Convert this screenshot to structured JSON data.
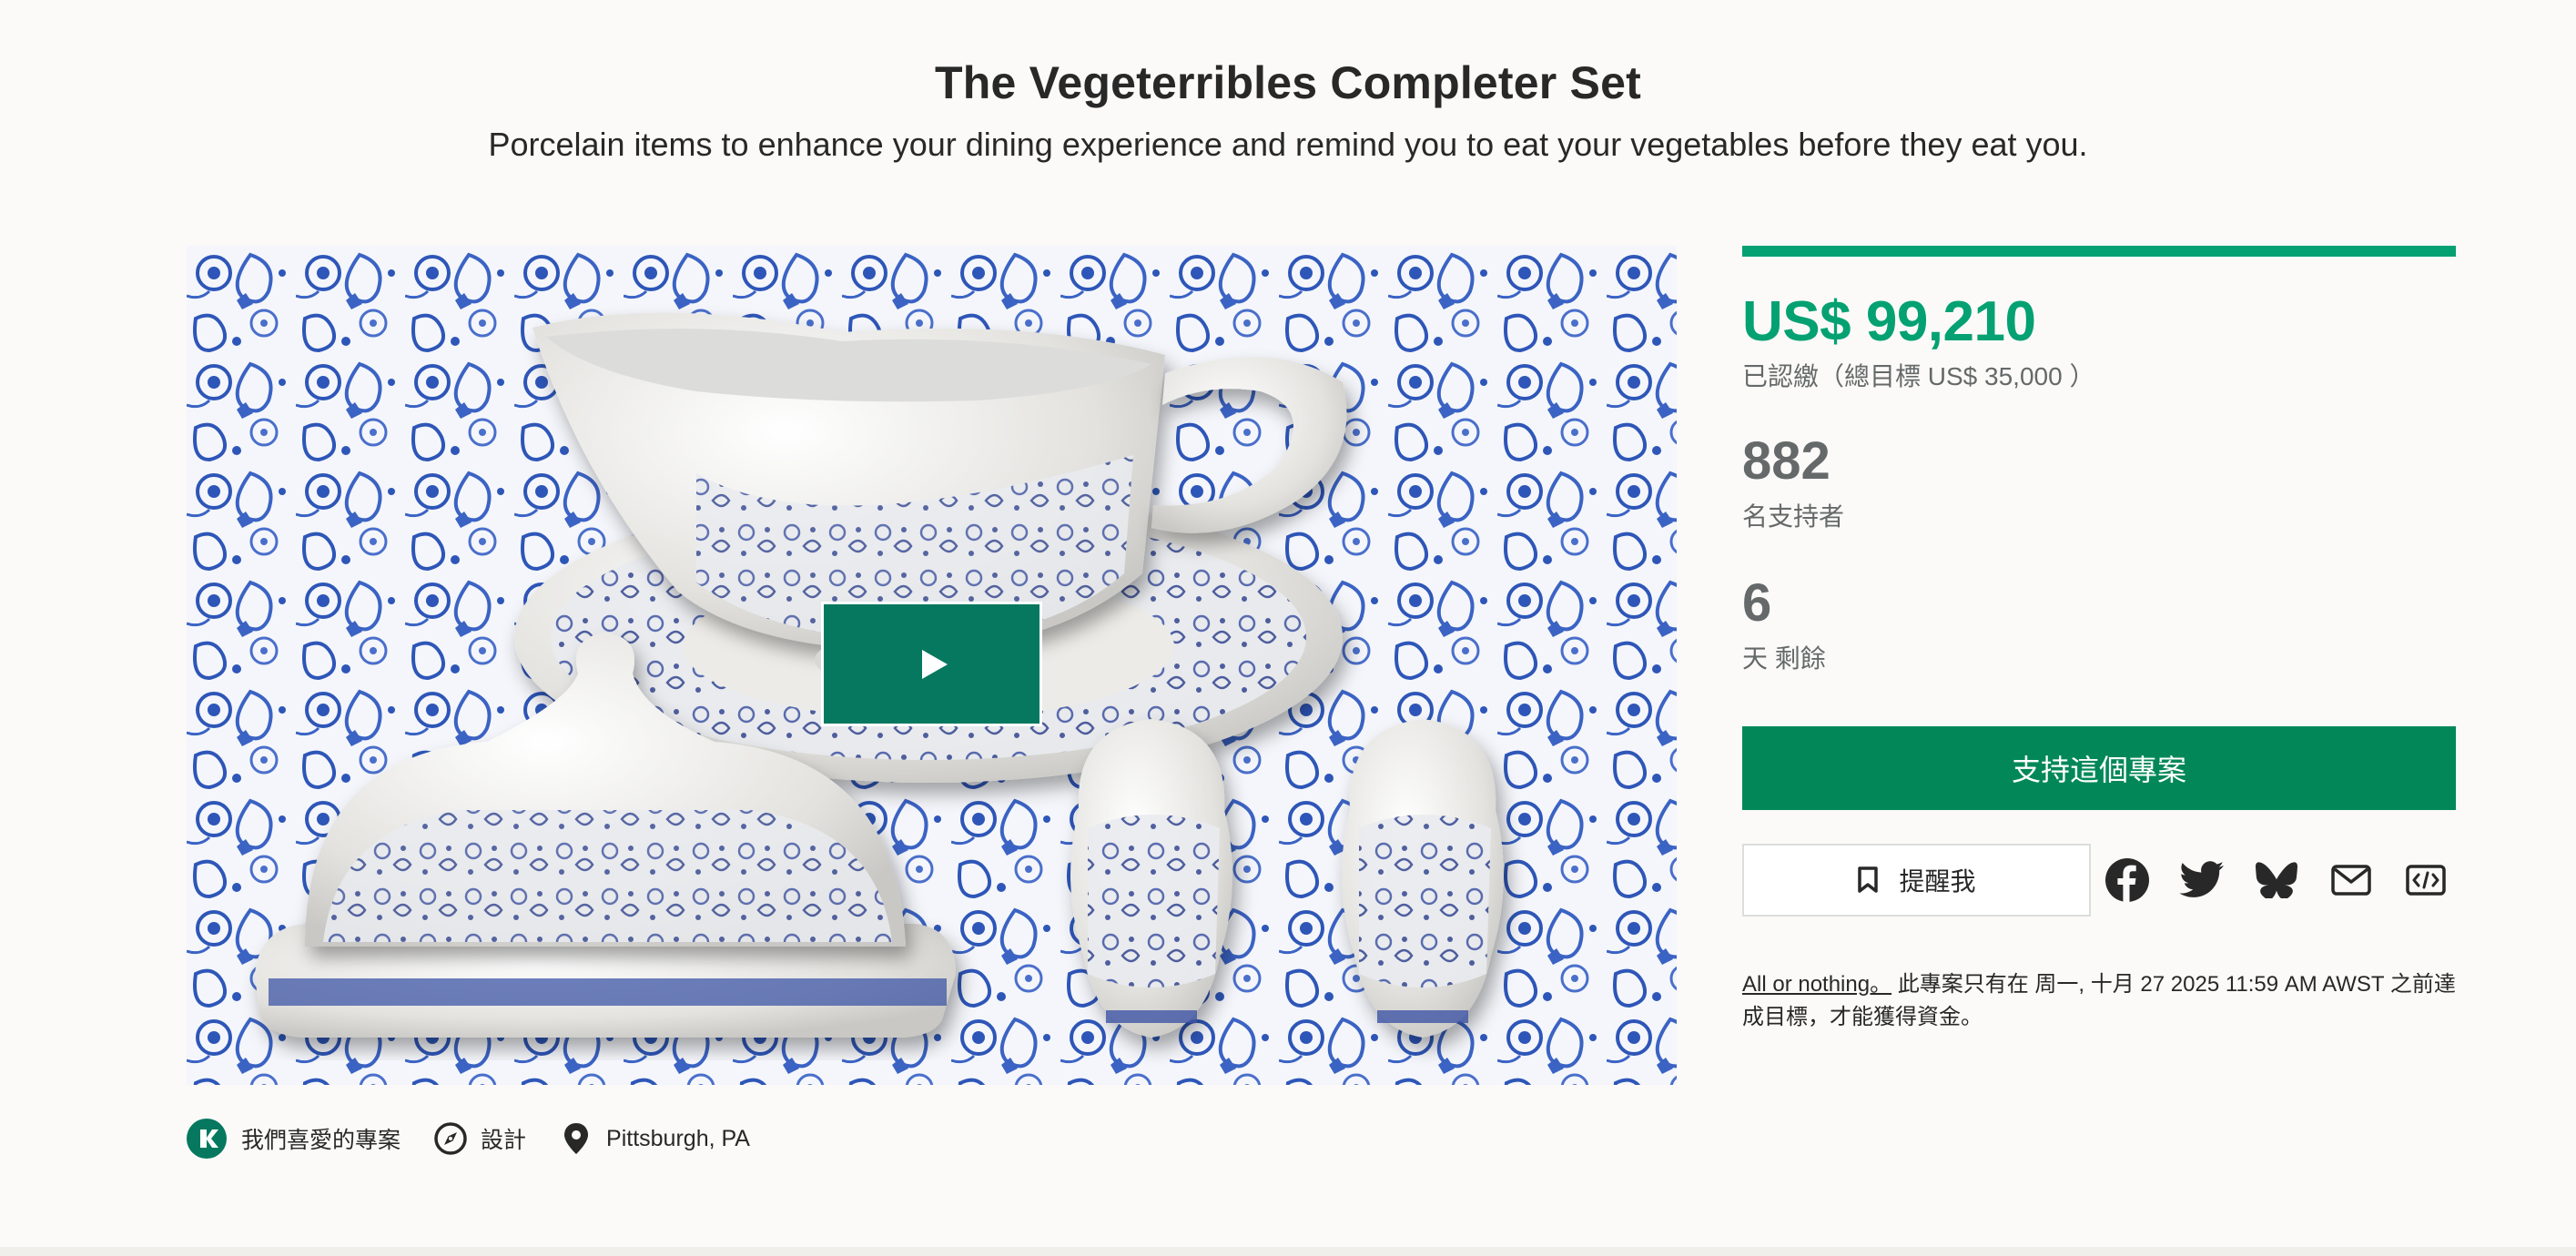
{
  "project": {
    "title": "The Vegeterribles Completer Set",
    "subtitle": "Porcelain items to enhance your dining experience and remind you to eat your vegetables before they eat you."
  },
  "media": {
    "play_icon": "play-icon"
  },
  "tags": [
    {
      "icon": "kickstarter-logo-icon",
      "label": "我們喜愛的專案"
    },
    {
      "icon": "compass-icon",
      "label": "設計"
    },
    {
      "icon": "location-pin-icon",
      "label": "Pittsburgh, PA"
    }
  ],
  "funding": {
    "progress_fraction": 1.0,
    "pledged": "US$ 99,210",
    "pledged_label": "已認繳（總目標 US$ 35,000 ）",
    "backers_count": "882",
    "backers_label": "名支持者",
    "days_count": "6",
    "days_label": "天 剩餘"
  },
  "actions": {
    "back_label": "支持這個專案",
    "remind_label": "提醒我",
    "share_icons": [
      "facebook-icon",
      "twitter-icon",
      "bluesky-icon",
      "email-icon",
      "embed-icon"
    ]
  },
  "note": {
    "link_text": "All or nothing。",
    "text": " 此專案只有在 周一, 十月 27 2025 11:59 AM AWST 之前達成目標，才能獲得資金。"
  },
  "colors": {
    "brand_green": "#05a172",
    "button_green": "#028858",
    "play_green": "#05785f",
    "muted_text": "#656969"
  }
}
